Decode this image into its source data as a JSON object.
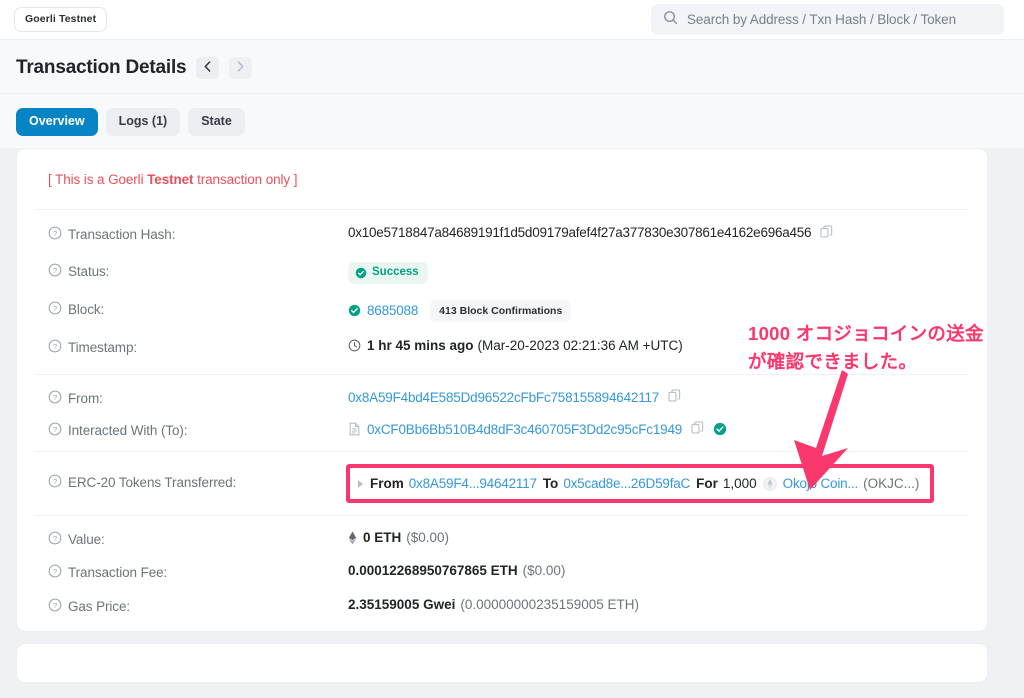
{
  "topbar": {
    "network_badge": "Goerli Testnet",
    "search_placeholder": "Search by Address / Txn Hash / Block / Token",
    "search_value": "",
    "search_icon": "search-icon"
  },
  "header": {
    "title": "Transaction Details",
    "prev_icon": "chevron-left-icon",
    "next_icon": "chevron-right-icon"
  },
  "tabs": [
    {
      "label": "Overview",
      "active": true
    },
    {
      "label": "Logs (1)",
      "active": false
    },
    {
      "label": "State",
      "active": false
    }
  ],
  "notice": {
    "prefix": "[ This is a Goerli ",
    "emphasis": "Testnet",
    "suffix": " transaction only ]"
  },
  "details": {
    "txn_hash": {
      "label": "Transaction Hash:",
      "value": "0x10e5718847a84689191f1d5d09179afef4f27a377830e307861e4162e696a456",
      "copy_icon": "copy-icon"
    },
    "status": {
      "label": "Status:",
      "badge": "Success",
      "badge_icon": "check-circle-icon"
    },
    "block": {
      "label": "Block:",
      "number": "8685088",
      "confirmations": "413 Block Confirmations",
      "icon": "check-circle-icon"
    },
    "timestamp": {
      "label": "Timestamp:",
      "relative": "1 hr 45 mins ago",
      "absolute": "(Mar-20-2023 02:21:36 AM +UTC)",
      "icon": "clock-icon"
    },
    "from": {
      "label": "From:",
      "address": "0x8A59F4bd4E585Dd96522cFbFc758155894642117",
      "copy_icon": "copy-icon"
    },
    "to": {
      "label": "Interacted With (To):",
      "address": "0xCF0Bb6Bb510B4d8dF3c460705F3Dd2c95cFc1949",
      "contract_icon": "contract-document-icon",
      "copy_icon": "copy-icon",
      "verified_icon": "check-circle-icon"
    },
    "erc20": {
      "label": "ERC-20 Tokens Transferred:",
      "expand_icon": "caret-right-icon",
      "from_word": "From",
      "from_address": "0x8A59F4...94642117",
      "to_word": "To",
      "to_address": "0x5cad8e...26D59faC",
      "for_word": "For",
      "amount": "1,000",
      "token_icon": "token-circle-icon",
      "token_name": "Okojo Coin...",
      "token_symbol": "(OKJC...)"
    },
    "value": {
      "label": "Value:",
      "icon": "ethereum-diamond-icon",
      "amount": "0 ETH",
      "fiat": "($0.00)"
    },
    "txn_fee": {
      "label": "Transaction Fee:",
      "amount": "0.00012268950767865 ETH",
      "fiat": "($0.00)"
    },
    "gas_price": {
      "label": "Gas Price:",
      "amount": "2.35159005 Gwei",
      "eth": "(0.00000000235159005 ETH)"
    }
  },
  "annotation": {
    "text": "1000 オコジョコインの送金が確認できました。",
    "color": "#f9386d"
  },
  "colors": {
    "accent_blue": "#0784c3",
    "link_blue": "#3498db",
    "success_green": "#00a186",
    "notice_red": "#e8505b",
    "highlight_pink": "#f9386d",
    "page_bg": "#f0f1f5"
  }
}
